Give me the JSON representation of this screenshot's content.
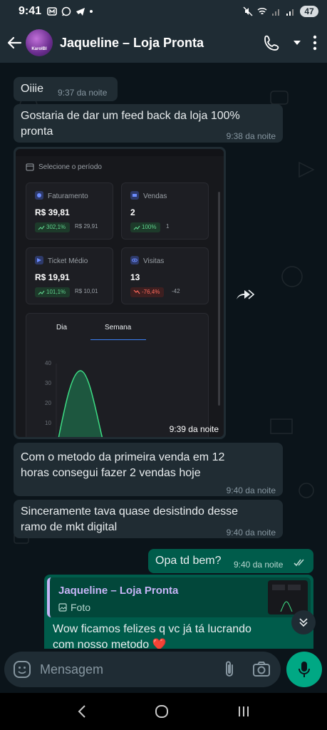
{
  "status_bar": {
    "time": "9:41",
    "battery": "47"
  },
  "header": {
    "contact_name": "Jaqueline – Loja Pronta",
    "avatar_text": "KarolBI"
  },
  "messages": [
    {
      "text": "Oiiie",
      "time": "9:37 da noite"
    },
    {
      "text_line1": "Gostaria de dar um feed back da loja 100%",
      "text_line2": "pronta",
      "time": "9:38 da noite"
    },
    {
      "time": "9:39 da noite"
    },
    {
      "text_line1": "Com o metodo da primeira venda em 12",
      "text_line2": "horas consegui fazer 2 vendas hoje",
      "time": "9:40 da noite"
    },
    {
      "text_line1": "Sinceramente tava quase desistindo desse",
      "text_line2": "ramo de mkt digital",
      "time": "9:40 da noite"
    },
    {
      "text": "Opa td bem?",
      "time": "9:40 da noite"
    },
    {
      "quote_author": "Jaqueline – Loja Pronta",
      "quote_type": "Foto",
      "text_line1": "Wow ficamos felizes q vc já tá lucrando",
      "text_line2": "com nosso metodo ❤️"
    }
  ],
  "dashboard": {
    "period_label": "Selecione o período",
    "cards": [
      {
        "title": "Faturamento",
        "value": "R$ 39,81",
        "badge": "302,1%",
        "prev": "R$ 29,91",
        "trend": "up"
      },
      {
        "title": "Vendas",
        "value": "2",
        "badge": "100%",
        "prev": "1",
        "trend": "up"
      },
      {
        "title": "Ticket Médio",
        "value": "R$ 19,91",
        "badge": "101,1%",
        "prev": "R$ 10,01",
        "trend": "up"
      },
      {
        "title": "Visitas",
        "value": "13",
        "badge": "-76,4%",
        "prev": "-42",
        "trend": "down"
      }
    ],
    "tabs": [
      "Dia",
      "Semana"
    ],
    "active_tab": "Semana",
    "y_ticks": [
      "40",
      "30",
      "20",
      "10"
    ]
  },
  "input": {
    "placeholder": "Mensagem"
  },
  "colors": {
    "incoming": "#202c33",
    "outgoing": "#005c4b",
    "accent": "#00a884",
    "header": "#1f2c34"
  }
}
